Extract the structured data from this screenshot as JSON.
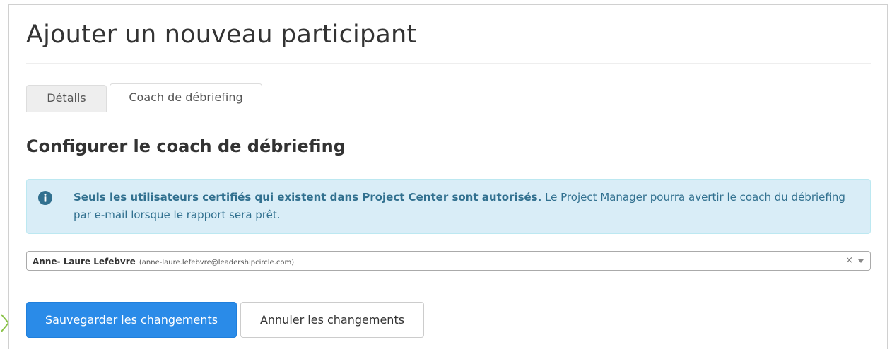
{
  "page": {
    "title": "Ajouter un nouveau participant"
  },
  "tabs": [
    {
      "label": "Détails",
      "active": false
    },
    {
      "label": "Coach de débriefing",
      "active": true
    }
  ],
  "section": {
    "title": "Configurer le coach de débriefing"
  },
  "alert": {
    "icon": "info-circle-icon",
    "strong_text": "Seuls les utilisateurs certifiés qui existent dans Project Center sont autorisés.",
    "text": " Le Project Manager pourra avertir le coach du débriefing par e-mail lorsque le rapport sera prêt."
  },
  "coach_select": {
    "selected_name": "Anne- Laure Lefebvre",
    "selected_email": "(anne-laure.lefebvre@leadershipcircle.com)",
    "clear_symbol": "×"
  },
  "actions": {
    "save_label": "Sauvegarder les changements",
    "cancel_label": "Annuler les changements"
  },
  "colors": {
    "primary": "#2a8be8",
    "alert_bg": "#d9edf7",
    "alert_text": "#31708f",
    "hint_arrow": "#8bc34a"
  }
}
